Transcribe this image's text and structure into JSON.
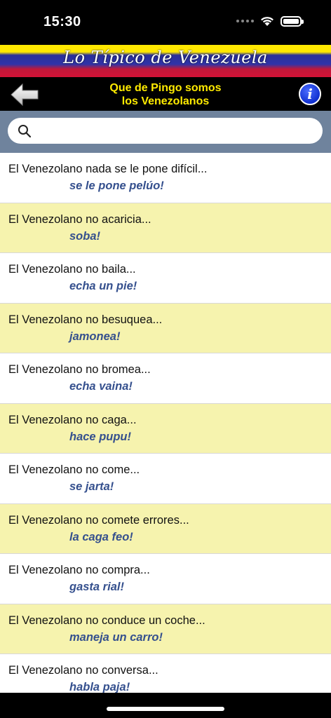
{
  "status_bar": {
    "time": "15:30"
  },
  "banner": {
    "title": "Lo Típico de Venezuela"
  },
  "nav": {
    "title_line1": "Que de Pingo somos",
    "title_line2": "los Venezolanos",
    "info_label": "i"
  },
  "search": {
    "placeholder": "",
    "value": ""
  },
  "colors": {
    "alt_row": "#f6f3ae",
    "answer_text": "#35508e",
    "nav_title": "#ffeb00",
    "search_bar": "#6f839d"
  },
  "items": [
    {
      "phrase": "El Venezolano nada se le pone difícil...",
      "answer": "se le pone pelúo!"
    },
    {
      "phrase": "El Venezolano no acaricia...",
      "answer": "soba!"
    },
    {
      "phrase": "El Venezolano no baila...",
      "answer": "echa un pie!"
    },
    {
      "phrase": "El Venezolano no besuquea...",
      "answer": "jamonea!"
    },
    {
      "phrase": "El Venezolano no bromea...",
      "answer": "echa vaina!"
    },
    {
      "phrase": "El Venezolano no caga...",
      "answer": "hace pupu!"
    },
    {
      "phrase": "El Venezolano no come...",
      "answer": "se jarta!"
    },
    {
      "phrase": "El Venezolano no comete errores...",
      "answer": "la caga feo!"
    },
    {
      "phrase": "El Venezolano no compra...",
      "answer": "gasta rial!"
    },
    {
      "phrase": "El Venezolano no conduce un coche...",
      "answer": "maneja un carro!"
    },
    {
      "phrase": "El Venezolano no conversa...",
      "answer": "habla paja!"
    }
  ]
}
